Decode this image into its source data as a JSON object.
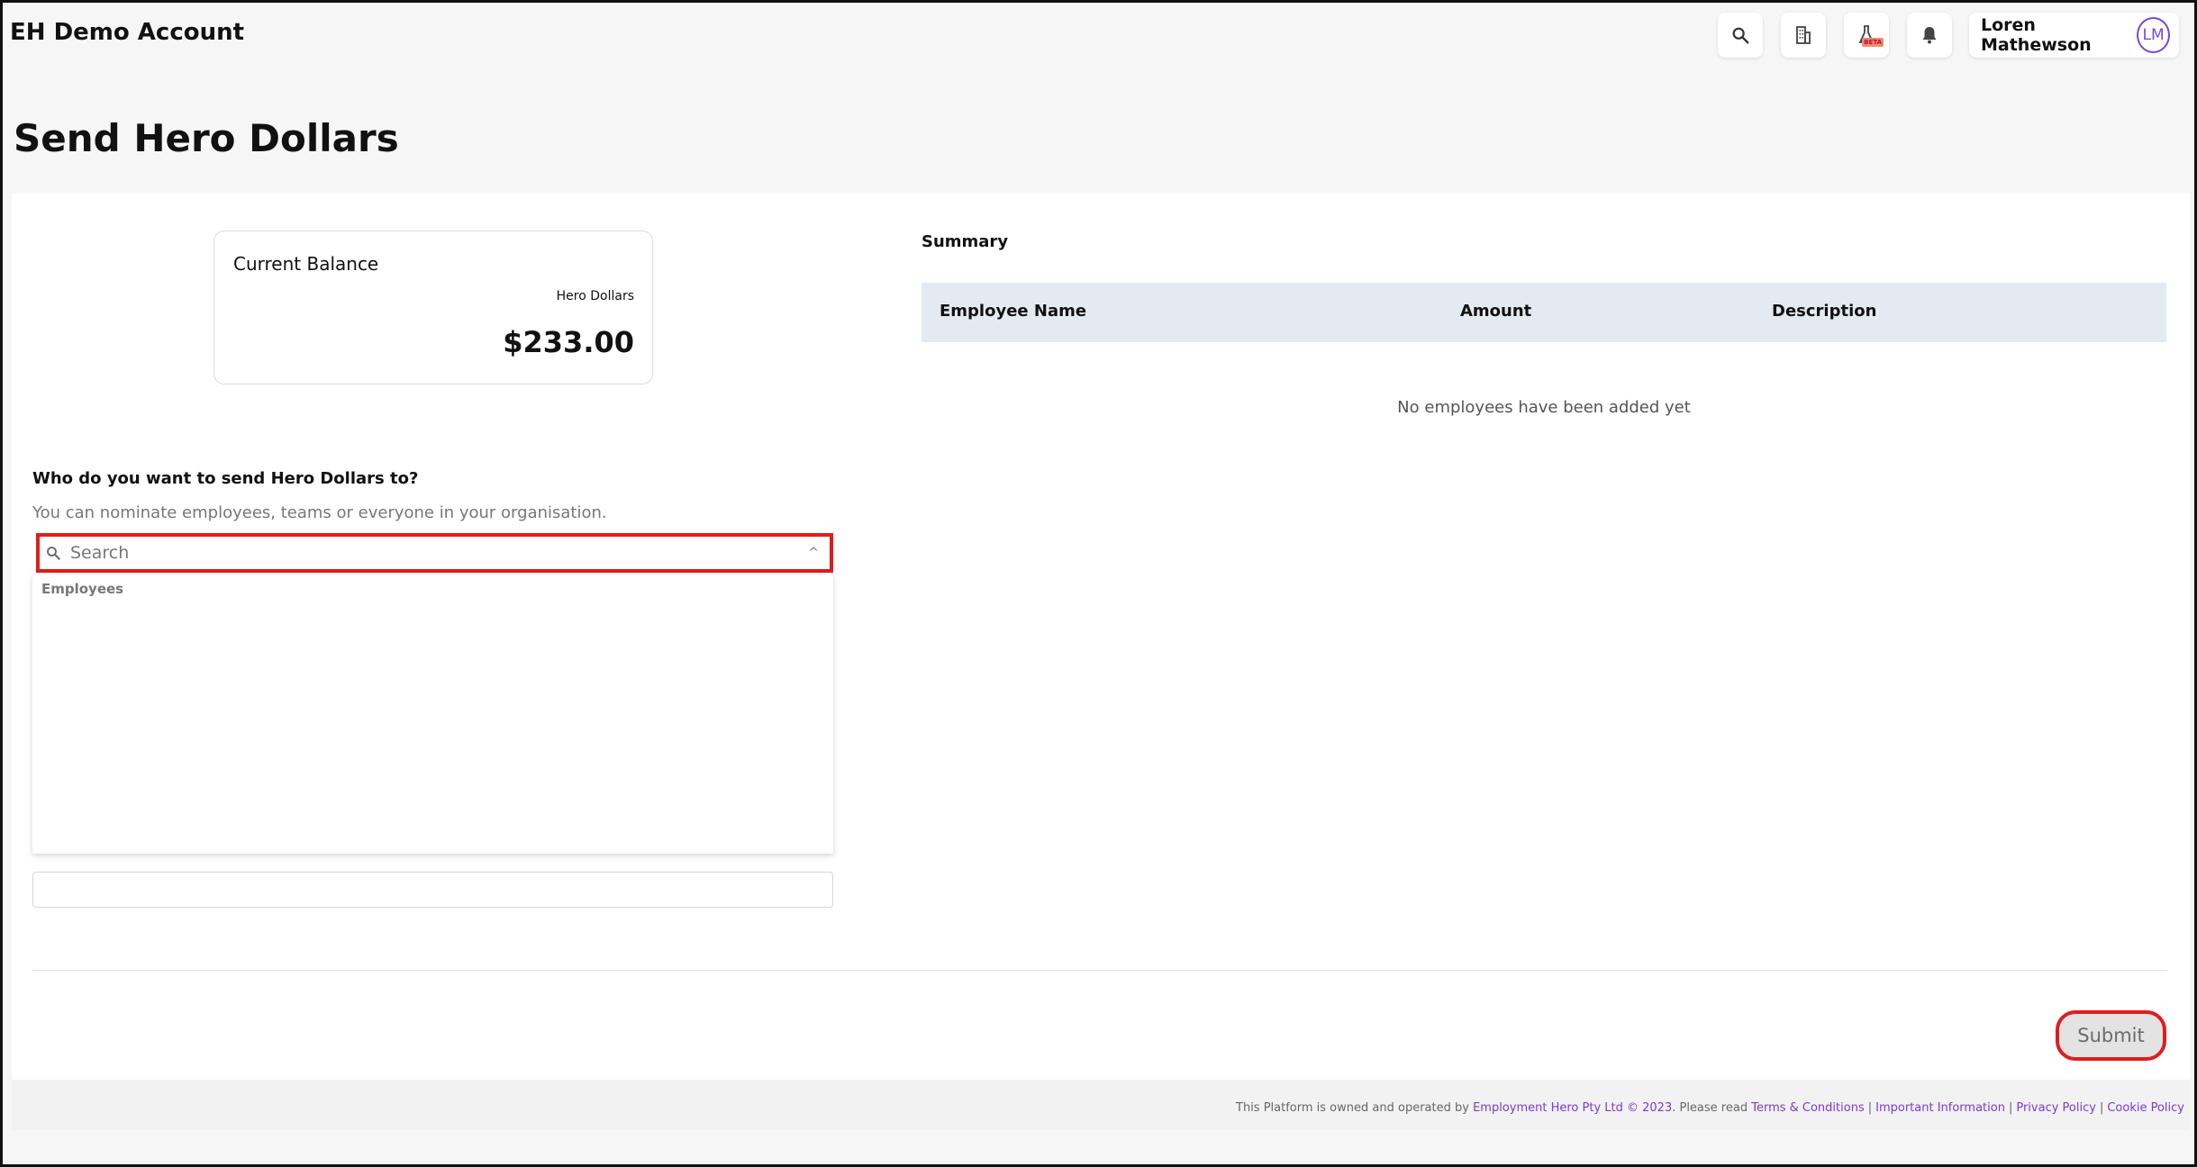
{
  "header": {
    "account_name": "EH Demo Account",
    "user_name": "Loren Mathewson",
    "user_initials": "LM",
    "beta_label": "BETA"
  },
  "page": {
    "title": "Send Hero Dollars"
  },
  "balance": {
    "title": "Current Balance",
    "unit_label": "Hero Dollars",
    "amount": "$233.00"
  },
  "recipient": {
    "question": "Who do you want to send Hero Dollars to?",
    "help": "You can nominate employees, teams or everyone in your organisation.",
    "search_placeholder": "Search",
    "dropdown_group": "Employees"
  },
  "summary": {
    "title": "Summary",
    "columns": [
      "Employee Name",
      "Amount",
      "Description"
    ],
    "empty_message": "No employees have been added yet"
  },
  "actions": {
    "submit_label": "Submit"
  },
  "footer": {
    "prefix": "This Platform is owned and operated by",
    "company": "Employment Hero Pty Ltd © 2023",
    "please_read": ". Please read",
    "links": [
      "Terms & Conditions",
      "Important Information",
      "Privacy Policy",
      "Cookie Policy"
    ]
  },
  "colors": {
    "accent": "#7d45d8",
    "highlight": "#e01d1d",
    "table_header": "#e3eaf2"
  }
}
